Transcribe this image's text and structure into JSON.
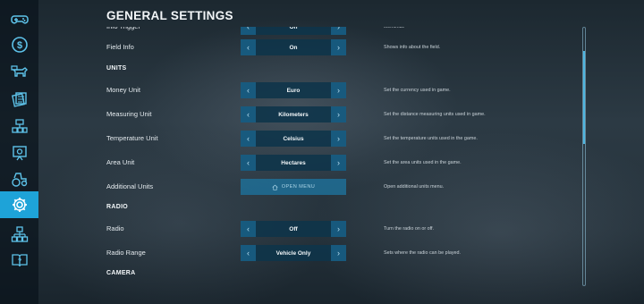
{
  "page": {
    "title": "GENERAL SETTINGS"
  },
  "sidebar": {
    "accent": "#1ea3d8",
    "items": [
      {
        "icon": "gamepad-icon",
        "active": false
      },
      {
        "icon": "dollar-coin-icon",
        "active": false
      },
      {
        "icon": "animals-icon",
        "active": false
      },
      {
        "icon": "contracts-icon",
        "active": false
      },
      {
        "icon": "production-chains-icon",
        "active": false
      },
      {
        "icon": "presentation-icon",
        "active": false
      },
      {
        "icon": "vehicles-icon",
        "active": false
      },
      {
        "icon": "settings-gear-icon",
        "active": true
      },
      {
        "icon": "hierarchy-icon",
        "active": false
      },
      {
        "icon": "help-book-icon",
        "active": false
      }
    ]
  },
  "settings": {
    "cut_row": {
      "label": "Info Trigger",
      "value": "On",
      "desc": "elements."
    },
    "field_info": {
      "label": "Field Info",
      "value": "On",
      "desc": "Shows info about the field."
    },
    "units_header": "UNITS",
    "money_unit": {
      "label": "Money Unit",
      "value": "Euro",
      "desc": "Set the currency used in game."
    },
    "measuring_unit": {
      "label": "Measuring Unit",
      "value": "Kilometers",
      "desc": "Set the distance measuring units used in game."
    },
    "temperature_unit": {
      "label": "Temperature Unit",
      "value": "Celsius",
      "desc": "Set the temperature units used in the game."
    },
    "area_unit": {
      "label": "Area Unit",
      "value": "Hectares",
      "desc": "Set the area units used in the game."
    },
    "additional_units": {
      "label": "Additional Units",
      "button": "OPEN MENU",
      "desc": "Open additional units menu."
    },
    "radio_header": "RADIO",
    "radio": {
      "label": "Radio",
      "value": "Off",
      "desc": "Turn the radio on or off."
    },
    "radio_range": {
      "label": "Radio Range",
      "value": "Vehicle Only",
      "desc": "Sets where the radio can be played."
    },
    "camera_header": "CAMERA"
  },
  "icons": {
    "prev": "chevron-left-icon",
    "next": "chevron-right-icon",
    "open_menu": "house-icon"
  },
  "scrollbar": {
    "position_fraction": 0.1,
    "visible_fraction": 0.36
  }
}
